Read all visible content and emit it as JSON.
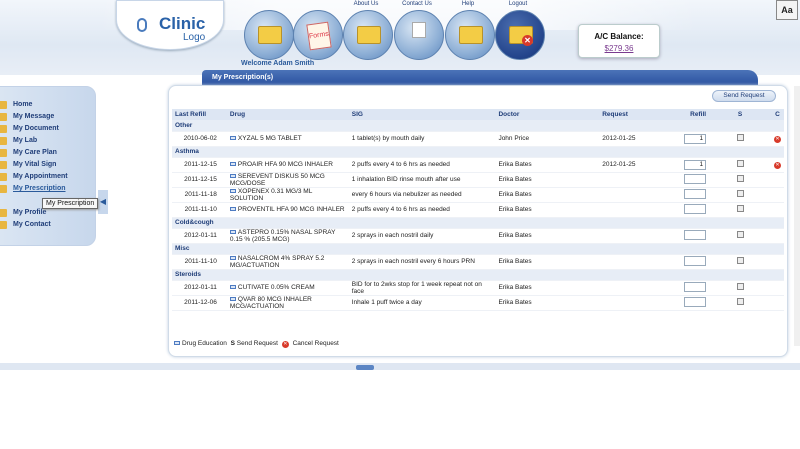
{
  "header": {
    "logo": {
      "line1": "Clinic",
      "line2": "Logo"
    },
    "nav": [
      {
        "label": "",
        "icon": "folder-home-icon"
      },
      {
        "label": "",
        "icon": "forms-icon",
        "badge": "Forms"
      },
      {
        "label": "About Us",
        "icon": "folder-users-icon"
      },
      {
        "label": "Contact Us",
        "icon": "folder-letter-icon"
      },
      {
        "label": "Help",
        "icon": "folder-help-icon"
      },
      {
        "label": "Logout",
        "icon": "folder-logout-icon"
      }
    ],
    "welcome": "Welcome Adam Smith",
    "balance_label": "A/C Balance:",
    "balance_value": "$279.36",
    "font_toggle": "Aa"
  },
  "sidebar": {
    "items": [
      "Home",
      "My Message",
      "My Document",
      "My Lab",
      "My Care Plan",
      "My Vital Sign",
      "My Appointment",
      "My Prescription",
      "My Profile",
      "My Contact"
    ],
    "selected": "My Prescription",
    "tooltip": "My Prescription"
  },
  "panel": {
    "title": "My Prescription(s)",
    "send_button": "Send Request",
    "columns": [
      "Last Refill",
      "Drug",
      "SIG",
      "Doctor",
      "Request",
      "Refill",
      "S",
      "C"
    ],
    "groups": [
      {
        "name": "Other",
        "rows": [
          {
            "last": "2010-06-02",
            "drug": "XYZAL 5 MG TABLET",
            "sig": "1 tablet(s) by mouth daily",
            "doctor": "John Price",
            "request": "2012-01-25",
            "refill": "1",
            "cancel": true
          }
        ]
      },
      {
        "name": "Asthma",
        "rows": [
          {
            "last": "2011-12-15",
            "drug": "PROAIR HFA 90 MCG INHALER",
            "sig": "2 puffs every 4 to 6 hrs as needed",
            "doctor": "Erika Bates",
            "request": "2012-01-25",
            "refill": "1",
            "cancel": true
          },
          {
            "last": "2011-12-15",
            "drug": "SEREVENT DISKUS 50 MCG MCG/DOSE",
            "sig": "1 inhalation BID rinse mouth after use",
            "doctor": "Erika Bates",
            "request": "",
            "refill": "",
            "cancel": false
          },
          {
            "last": "2011-11-18",
            "drug": "XOPENEX 0.31 MG/3 ML SOLUTION",
            "sig": "every 6 hours via nebulizer as needed",
            "doctor": "Erika Bates",
            "request": "",
            "refill": "",
            "cancel": false
          },
          {
            "last": "2011-11-10",
            "drug": "PROVENTIL HFA 90 MCG INHALER",
            "sig": "2 puffs every 4 to 6 hrs as needed",
            "doctor": "Erika Bates",
            "request": "",
            "refill": "",
            "cancel": false
          }
        ]
      },
      {
        "name": "Cold&cough",
        "rows": [
          {
            "last": "2012-01-11",
            "drug": "ASTEPRO 0.15% NASAL SPRAY 0.15 % (205.5 MCG)",
            "sig": "2 sprays in each nostril daily",
            "doctor": "Erika Bates",
            "request": "",
            "refill": "",
            "cancel": false
          }
        ]
      },
      {
        "name": "Misc",
        "rows": [
          {
            "last": "2011-11-10",
            "drug": "NASALCROM 4% SPRAY 5.2 MG/ACTUATION",
            "sig": "2 sprays in each nostril every 6 hours PRN",
            "doctor": "Erika Bates",
            "request": "",
            "refill": "",
            "cancel": false
          }
        ]
      },
      {
        "name": "Steroids",
        "rows": [
          {
            "last": "2012-01-11",
            "drug": "CUTIVATE 0.05% CREAM",
            "sig": "BID for to 2wks stop for 1 week repeat not on face",
            "doctor": "Erika Bates",
            "request": "",
            "refill": "",
            "cancel": false
          },
          {
            "last": "2011-12-06",
            "drug": "QVAR 80 MCG INHALER MCG/ACTUATION",
            "sig": "Inhale 1 puff twice a day",
            "doctor": "Erika Bates",
            "request": "",
            "refill": "",
            "cancel": false
          }
        ]
      }
    ],
    "legend": {
      "edu": "Drug Education",
      "send_key": "S",
      "send": "Send Request",
      "cancel": "Cancel Request"
    }
  }
}
